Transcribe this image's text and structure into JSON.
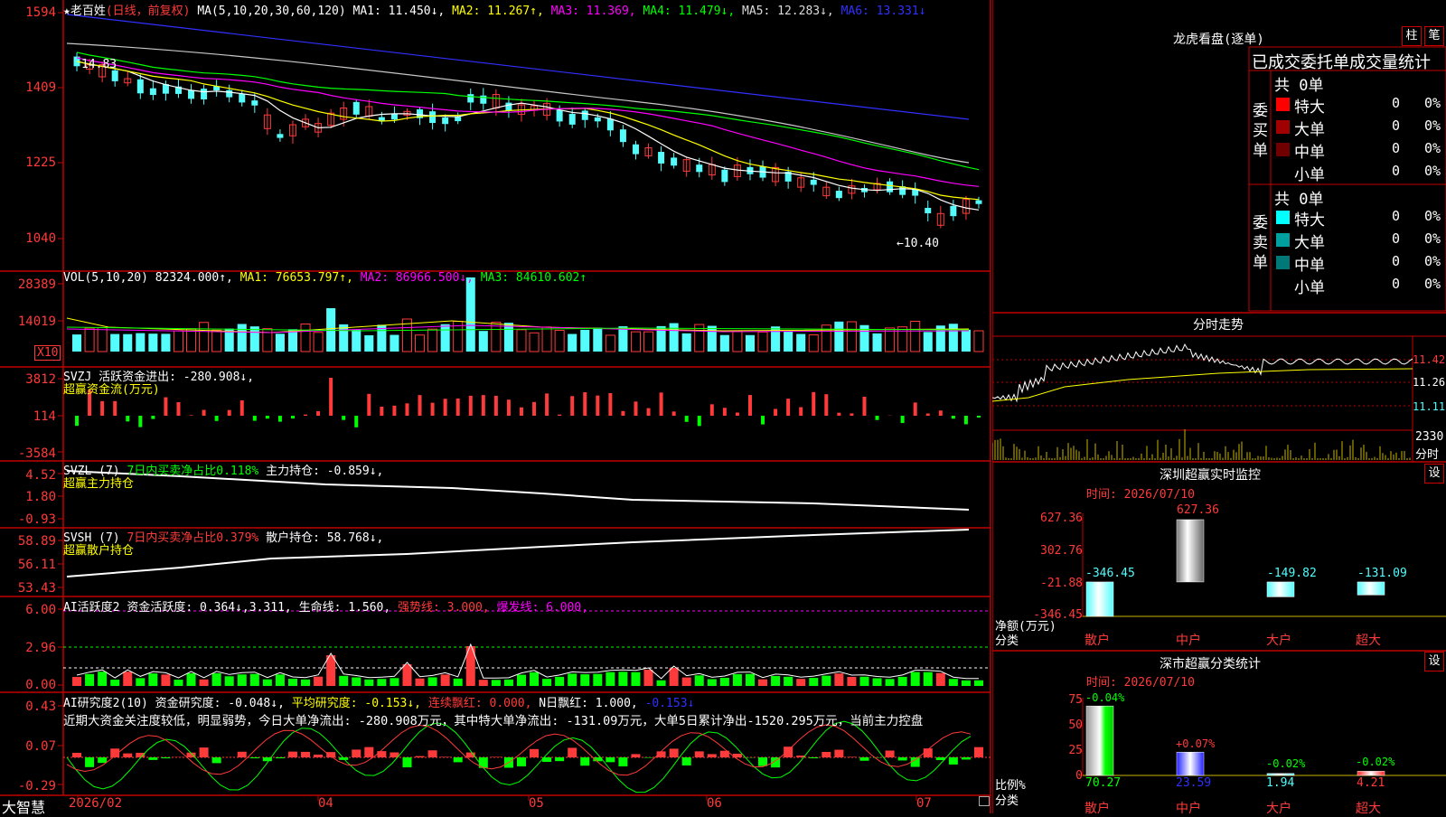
{
  "app": {
    "name": "大智慧"
  },
  "colors": {
    "up": "#ff3a3a",
    "down": "#54fcfc",
    "grid": "#c00000",
    "ma1": "#ffffff",
    "ma2": "#ffff00",
    "ma3": "#ff00ff",
    "ma4": "#00ff00",
    "ma5": "#c8c8c8",
    "ma6": "#3030ff",
    "panel_border": "#c00000"
  },
  "main": {
    "stock": "★老百姓",
    "period": "(日线，前复权)",
    "ma_params": "MA(5,10,20,30,60,120)",
    "ma1": "MA1: 11.450↓,",
    "ma2": "MA2: 11.267↑,",
    "ma3": "MA3: 11.369,",
    "ma4": "MA4: 11.479↓,",
    "ma5": "MA5: 12.283↓,",
    "ma6": "MA6: 13.331↓",
    "y_labels": [
      "1594",
      "1409",
      "1225",
      "1040"
    ],
    "high_marker": "14.83",
    "low_marker": "←10.40"
  },
  "vol": {
    "params": "VOL(5,10,20)",
    "value": "82324.000↑,",
    "ma1": "MA1: 76653.797↑,",
    "ma2": "MA2: 86966.500↓,",
    "ma3": "MA3: 84610.602↑",
    "y_labels": [
      "28389",
      "14019"
    ],
    "scale": "X10"
  },
  "svzj": {
    "title": "SVZJ  活跃资金进出: -280.908↓,",
    "subtitle": "超赢资金流(万元)",
    "y_labels": [
      "3812",
      "114",
      "-3584"
    ]
  },
  "svzl": {
    "name": "SVZL (7)",
    "ratio": "7日内买卖净占比0.118%",
    "hold": "主力持仓: -0.859↓,",
    "subtitle": "超赢主力持仓",
    "y_labels": [
      "4.52",
      "1.80",
      "-0.93"
    ]
  },
  "svsh": {
    "name": "SVSH (7)",
    "ratio": "7日内买卖净占比0.379%",
    "hold": "散户持仓: 58.768↓,",
    "subtitle": "超赢散户持仓",
    "y_labels": [
      "58.89",
      "56.11",
      "53.43"
    ]
  },
  "ai1": {
    "name": "AI活跃度2",
    "a": "资金活跃度: 0.364↓,",
    "b": "3.311,",
    "c": "生命线: 1.560,",
    "d": "强势线: 3.000,",
    "e": "爆发线: 6.000,",
    "y_labels": [
      "6.00",
      "2.96",
      "0.00"
    ]
  },
  "ai2": {
    "name": "AI研究度2(10)",
    "a": "资金研究度: -0.048↓,",
    "b": "平均研究度: -0.153↓,",
    "c": "连续飘红: 0.000,",
    "d": "N日飘红: 1.000,",
    "e": "-0.153↓",
    "comment": "近期大资金关注度较低，明显弱势，今日大单净流出: -280.908万元，其中特大单净流出: -131.09万元，大单5日累计净出-1520.295万元，当前主力控盘",
    "y_labels": [
      "0.43",
      "0.07",
      "-0.29"
    ]
  },
  "xaxis": [
    "2026/02",
    "04",
    "05",
    "06",
    "07"
  ],
  "dragon": {
    "title": "龙虎看盘(逐单)",
    "btn1": "柱",
    "btn2": "笔",
    "header": "已成交委托单成交量统计",
    "buy_label": "委买单",
    "sell_label": "委卖单",
    "buy_total": "共 0单",
    "sell_total": "共 0单",
    "buy_rows": [
      {
        "name": "特大",
        "count": "0",
        "pct": "0%",
        "color": "#ff0000"
      },
      {
        "name": "大单",
        "count": "0",
        "pct": "0%",
        "color": "#a00000"
      },
      {
        "name": "中单",
        "count": "0",
        "pct": "0%",
        "color": "#700000"
      },
      {
        "name": "小单",
        "count": "0",
        "pct": "0%",
        "color": "#000000"
      }
    ],
    "sell_rows": [
      {
        "name": "特大",
        "count": "0",
        "pct": "0%",
        "color": "#00ffff"
      },
      {
        "name": "大单",
        "count": "0",
        "pct": "0%",
        "color": "#00a0a0"
      },
      {
        "name": "中单",
        "count": "0",
        "pct": "0%",
        "color": "#007878"
      },
      {
        "name": "小单",
        "count": "0",
        "pct": "0%",
        "color": "#000000"
      }
    ]
  },
  "intraday": {
    "title": "分时走势",
    "y_labels": [
      "11.42",
      "11.26",
      "11.11"
    ],
    "vol_label": "2330",
    "bottom_label": "分时"
  },
  "monitor": {
    "title": "深圳超赢实时监控",
    "btn": "设",
    "time": "时间: 2026/07/10",
    "y_labels": [
      "627.36",
      "302.76",
      "-21.88",
      "-346.45"
    ],
    "ylabel": "净额(万元)",
    "xlabel": "分类",
    "cats": [
      "散户",
      "中户",
      "大户",
      "超大"
    ],
    "values_text": [
      "-346.45",
      "627.36",
      "-149.82",
      "-131.09"
    ]
  },
  "monitor_data": {
    "values": [
      -346.45,
      627.36,
      -149.82,
      -131.09
    ],
    "range": [
      -346.45,
      627.36
    ]
  },
  "classify": {
    "title": "深市超赢分类统计",
    "btn": "设",
    "time": "时间: 2026/07/10",
    "y_labels": [
      "75",
      "50",
      "25",
      "0"
    ],
    "ylabel": "比例%",
    "xlabel": "分类",
    "cats": [
      "散户",
      "中户",
      "大户",
      "超大"
    ],
    "values_text": [
      "70.27",
      "23.59",
      "1.94",
      "4.21"
    ],
    "change_text": [
      "-0.04%",
      "+0.07%",
      "-0.02%",
      "-0.02%"
    ]
  },
  "classify_data": {
    "values": [
      70.27,
      23.59,
      1.94,
      4.21
    ],
    "max": 75
  }
}
